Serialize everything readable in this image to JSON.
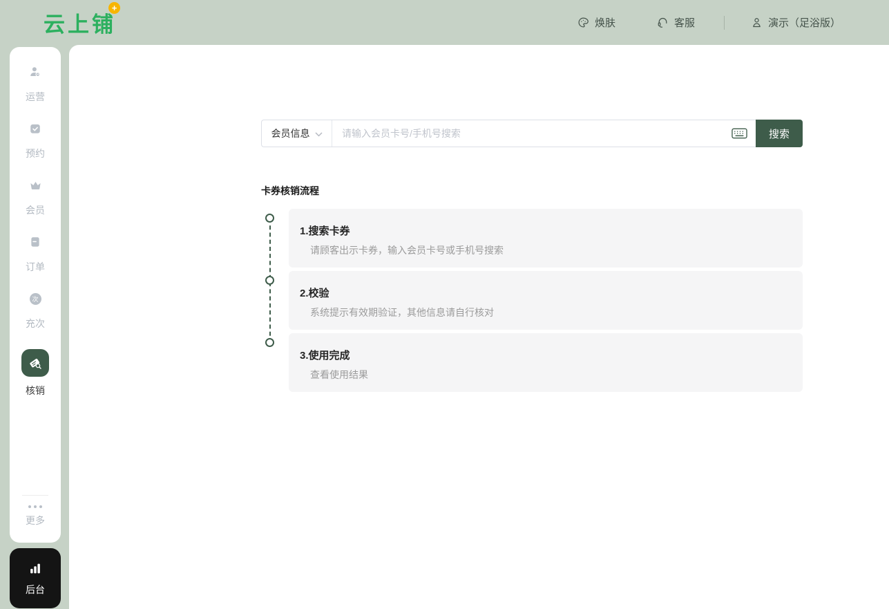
{
  "colors": {
    "page_bg": "#c6d2c6",
    "accent_green": "#3e5c4a",
    "logo_green": "#2cb05f",
    "badge_yellow": "#f7b500",
    "backend_black": "#141414",
    "card_bg": "#f5f5f6",
    "inactive_gray": "#b3bac2"
  },
  "header": {
    "logo_text": "云上铺",
    "logo_badge": "+",
    "nav": [
      {
        "label": "焕肤",
        "icon": "palette-icon"
      },
      {
        "label": "客服",
        "icon": "headset-icon"
      },
      {
        "label": "演示（足浴版）",
        "icon": "user-icon"
      }
    ]
  },
  "sidebar": {
    "items": [
      {
        "label": "运营",
        "icon": "operations-user-icon",
        "active": false
      },
      {
        "label": "预约",
        "icon": "calendar-check-icon",
        "active": false
      },
      {
        "label": "会员",
        "icon": "crown-icon",
        "active": false
      },
      {
        "label": "订单",
        "icon": "order-book-icon",
        "active": false
      },
      {
        "label": "充次",
        "icon": "recharge-times-icon",
        "icon_text": "次",
        "active": false
      },
      {
        "label": "核销",
        "icon": "ticket-verify-icon",
        "active": true
      },
      {
        "label": "更多",
        "icon": "more-dots-icon",
        "active": false
      }
    ],
    "backend": {
      "label": "后台",
      "icon": "bar-chart-icon"
    }
  },
  "search": {
    "category_label": "会员信息",
    "placeholder": "请输入会员卡号/手机号搜索",
    "keyboard_icon": "keyboard-icon",
    "button_label": "搜索"
  },
  "flow": {
    "title": "卡券核销流程",
    "steps": [
      {
        "title": "1.搜索卡券",
        "desc": "请顾客出示卡券，输入会员卡号或手机号搜索"
      },
      {
        "title": "2.校验",
        "desc": "系统提示有效期验证，其他信息请自行核对"
      },
      {
        "title": "3.使用完成",
        "desc": "查看使用结果"
      }
    ]
  }
}
